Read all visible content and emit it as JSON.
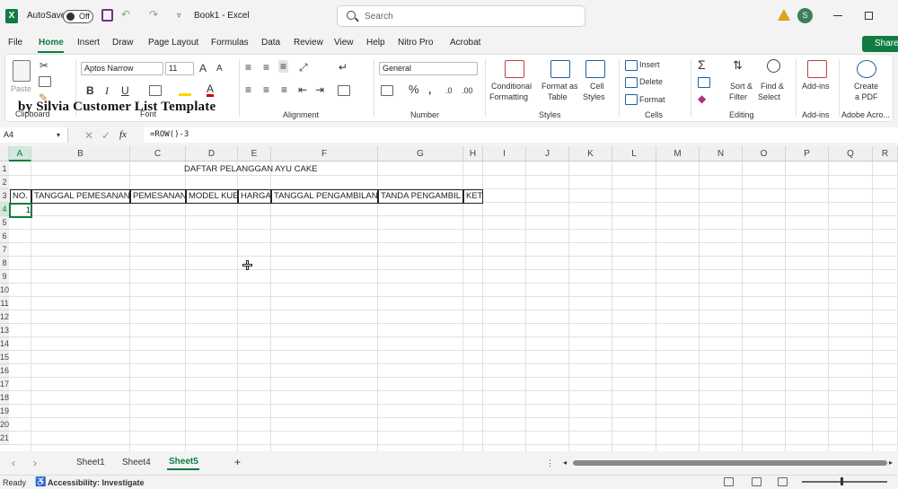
{
  "titlebar": {
    "autosave_label": "AutoSave",
    "autosave_state": "Off",
    "doc_title": "Book1 - Excel",
    "search_placeholder": "Search",
    "avatar_initial": "S",
    "accent": "#107c41"
  },
  "menu": [
    "File",
    "Home",
    "Insert",
    "Draw",
    "Page Layout",
    "Formulas",
    "Data",
    "Review",
    "View",
    "Help",
    "Nitro Pro",
    "Acrobat"
  ],
  "menu_active": "Home",
  "share_label": "Share",
  "ribbon": {
    "paste": "Paste",
    "clipboard": "Clipboard",
    "font_name": "Aptos Narrow",
    "font_size": "11",
    "font_group": "Font",
    "alignment": "Alignment",
    "number_format": "General",
    "number_group": "Number",
    "cond_format_1": "Conditional",
    "cond_format_2": "Formatting",
    "format_table_1": "Format as",
    "format_table_2": "Table",
    "cell_styles_1": "Cell",
    "cell_styles_2": "Styles",
    "styles_group": "Styles",
    "insert": "Insert",
    "delete": "Delete",
    "format": "Format",
    "cells_group": "Cells",
    "sort_1": "Sort &",
    "sort_2": "Filter",
    "find_1": "Find &",
    "find_2": "Select",
    "editing_group": "Editing",
    "addins": "Add-ins",
    "addins_group": "Add-ins",
    "create_pdf_1": "Create",
    "create_pdf_2": "a PDF",
    "adobe_group": "Adobe Acro..."
  },
  "watermark": "by  Silvia  Customer List Template",
  "formula_bar": {
    "name_box": "A4",
    "fx": "fx",
    "formula": "=ROW()-3"
  },
  "grid": {
    "columns": [
      "A",
      "B",
      "C",
      "D",
      "E",
      "F",
      "G",
      "H",
      "I",
      "J",
      "K",
      "L",
      "M",
      "N",
      "O",
      "P",
      "Q",
      "R"
    ],
    "rows": [
      "1",
      "2",
      "3",
      "4",
      "5",
      "6",
      "7",
      "8",
      "9",
      "10",
      "11",
      "12",
      "13",
      "14",
      "15",
      "16",
      "17",
      "18",
      "19",
      "20",
      "21"
    ],
    "title": "DAFTAR PELANGGAN AYU CAKE",
    "headers": [
      "NO.",
      "TANGGAL PEMESANAN",
      "PEMESANAN",
      "MODEL KUE",
      "HARGA",
      "TANGGAL PENGAMBILAN",
      "TANDA PENGAMBIL",
      "KET"
    ],
    "a4_value": "1",
    "active_cell": "A4"
  },
  "sheets": [
    "Sheet1",
    "Sheet4",
    "Sheet5"
  ],
  "active_sheet": "Sheet5",
  "add_sheet": "+",
  "status": {
    "ready": "Ready",
    "accessibility": "Accessibility: Investigate"
  }
}
